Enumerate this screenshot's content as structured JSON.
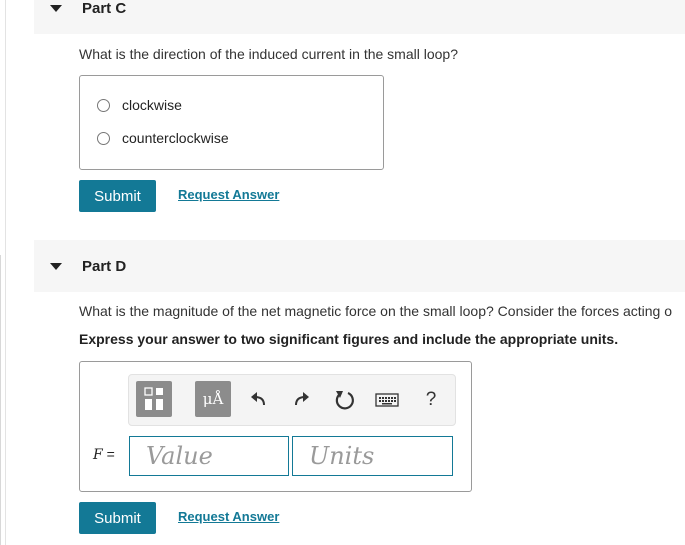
{
  "part_c": {
    "title": "Part C",
    "question": "What is the direction of the induced current in the small loop?",
    "options": [
      {
        "label": "clockwise"
      },
      {
        "label": "counterclockwise"
      }
    ],
    "submit_label": "Submit",
    "request_answer_label": "Request Answer"
  },
  "part_d": {
    "title": "Part D",
    "question": "What is the magnitude of the net magnetic force on the small loop? Consider the forces acting o",
    "instruction": "Express your answer to two significant figures and include the appropriate units.",
    "toolbar": {
      "units_label": "μÅ",
      "help_label": "?"
    },
    "variable": "F",
    "equals": " =",
    "value_placeholder": "Value",
    "units_placeholder": "Units",
    "submit_label": "Submit",
    "request_answer_label": "Request Answer"
  },
  "colors": {
    "accent": "#137996",
    "header_bg": "#f6f6f6",
    "toolbar_button": "#8c8c8c"
  }
}
